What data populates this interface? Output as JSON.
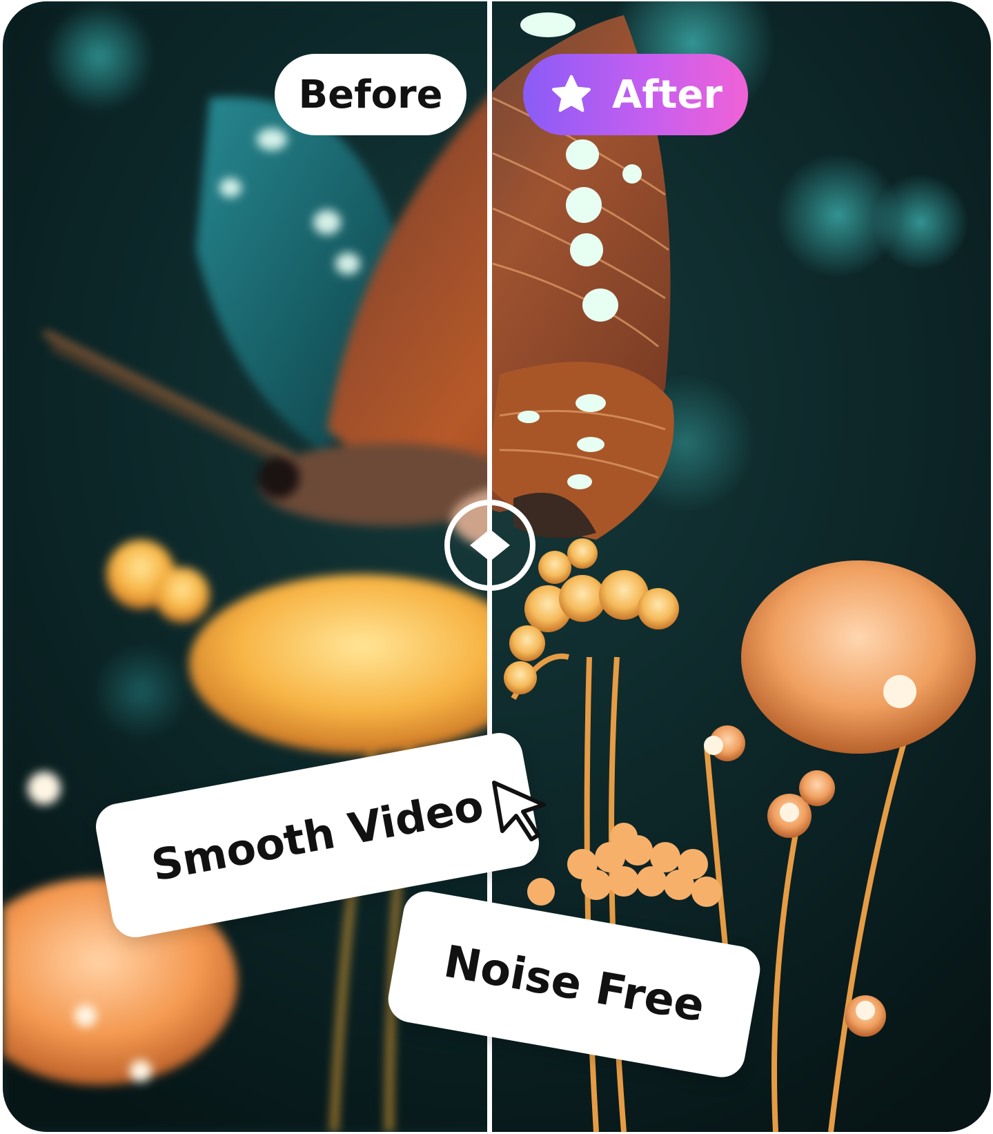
{
  "comparison": {
    "before_label": "Before",
    "after_label": "After"
  },
  "tags": {
    "smooth_video": "Smooth Video",
    "noise_free": "Noise Free"
  },
  "icons": {
    "after_badge": "star-icon",
    "slider_handle": "left-right-arrows-icon",
    "pointer": "cursor-arrow-icon"
  },
  "colors": {
    "after_gradient_start": "#8a5cf6",
    "after_gradient_end": "#f062d6",
    "divider": "#ffffff",
    "background": "#0d2a2c"
  }
}
